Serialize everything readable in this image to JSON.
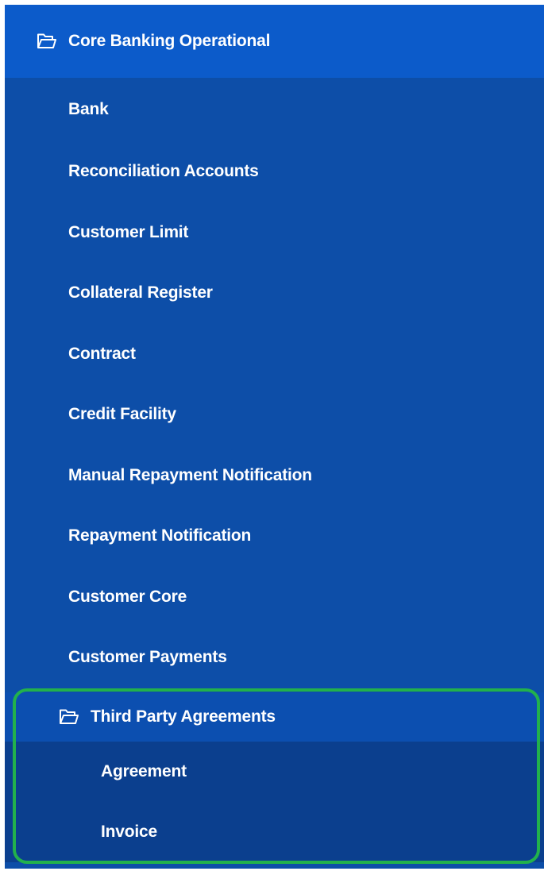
{
  "nav": {
    "header": {
      "label": "Core Banking Operational",
      "icon": "folder-open-icon"
    },
    "items": [
      {
        "label": "Bank"
      },
      {
        "label": "Reconciliation Accounts"
      },
      {
        "label": "Customer Limit"
      },
      {
        "label": "Collateral Register"
      },
      {
        "label": "Contract"
      },
      {
        "label": "Credit Facility"
      },
      {
        "label": "Manual Repayment Notification"
      },
      {
        "label": "Repayment Notification"
      },
      {
        "label": "Customer Core"
      },
      {
        "label": "Customer Payments"
      }
    ],
    "subgroup": {
      "label": "Third Party Agreements",
      "icon": "folder-open-icon",
      "items": [
        {
          "label": "Agreement"
        },
        {
          "label": "Invoice"
        }
      ]
    }
  },
  "colors": {
    "sidebar_bg": "#0d4ea8",
    "header_bg": "#0c5bca",
    "subgroup_header_bg": "#0c4fb0",
    "subgroup_items_bg": "#0b3f8e",
    "highlight": "#22b14c",
    "text": "#ffffff"
  }
}
